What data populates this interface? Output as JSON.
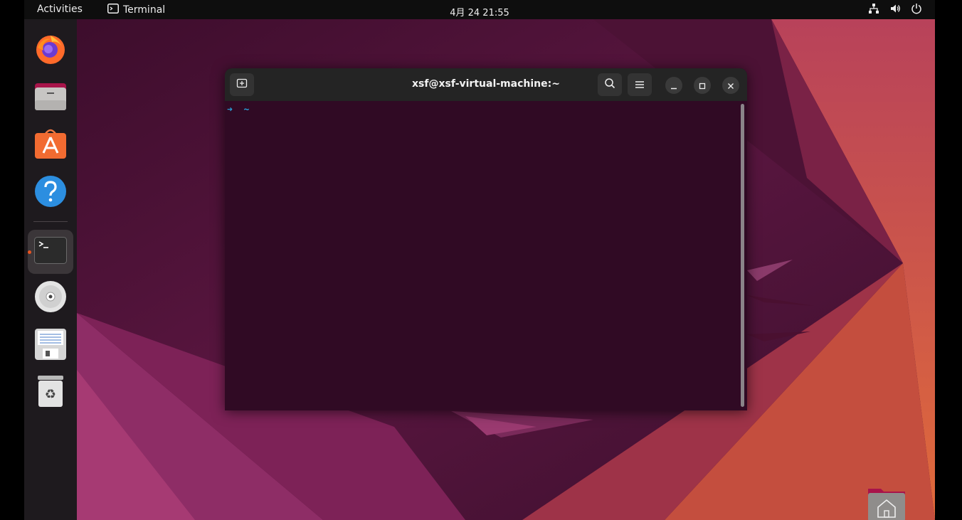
{
  "topbar": {
    "activities": "Activities",
    "app_name": "Terminal",
    "clock": "4月 24  21:55"
  },
  "dock": {
    "items": [
      "firefox",
      "files",
      "app-center",
      "help",
      "terminal",
      "optical-drive",
      "text-editor",
      "trash"
    ],
    "active": "terminal"
  },
  "terminal": {
    "title": "xsf@xsf-virtual-machine:~",
    "prompt_arrow": "➜",
    "prompt_dir": "~"
  },
  "colors": {
    "accent": "#e95420",
    "terminal_bg": "#300a24",
    "header_bg": "#242424",
    "prompt": "#2a9fd6"
  }
}
